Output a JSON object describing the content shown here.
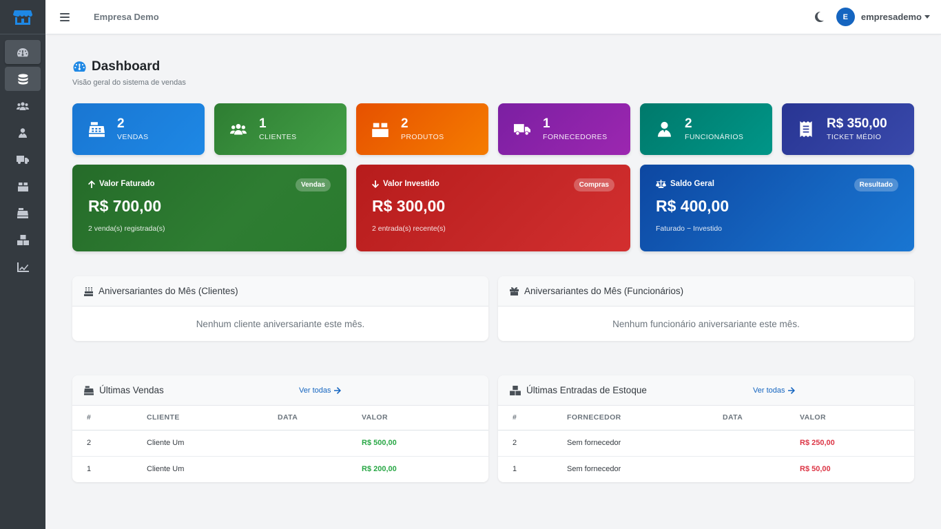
{
  "navbar": {
    "company": "Empresa Demo",
    "user_initial": "E",
    "user_name": "empresademo"
  },
  "sidebar": {
    "items": [
      {
        "icon": "tachometer-icon"
      },
      {
        "icon": "database-icon"
      },
      {
        "icon": "users-icon"
      },
      {
        "icon": "user-tie-icon"
      },
      {
        "icon": "truck-icon"
      },
      {
        "icon": "box-icon"
      },
      {
        "icon": "cash-register-icon"
      },
      {
        "icon": "boxes-icon"
      },
      {
        "icon": "chart-line-icon"
      }
    ]
  },
  "page": {
    "title": "Dashboard",
    "subtitle": "Visão geral do sistema de vendas"
  },
  "stats": [
    {
      "value": "2",
      "label": "VENDAS",
      "icon": "cash-register-icon",
      "color": "#1976d2"
    },
    {
      "value": "1",
      "label": "CLIENTES",
      "icon": "users-icon",
      "color": "#388e3c"
    },
    {
      "value": "2",
      "label": "PRODUTOS",
      "icon": "box-icon",
      "color": "#f57c00"
    },
    {
      "value": "1",
      "label": "FORNECEDORES",
      "icon": "truck-icon",
      "color": "#8e24aa"
    },
    {
      "value": "2",
      "label": "FUNCIONÁRIOS",
      "icon": "user-tie-icon",
      "color": "#00897b"
    },
    {
      "value": "R$ 350,00",
      "label": "TICKET MÉDIO",
      "icon": "receipt-icon",
      "color": "#303f9f"
    }
  ],
  "summary": [
    {
      "title": "Valor Faturado",
      "badge": "Vendas",
      "amount": "R$ 700,00",
      "note": "2 venda(s) registrada(s)",
      "icon": "arrow-up-icon",
      "color": "#2e7d32"
    },
    {
      "title": "Valor Investido",
      "badge": "Compras",
      "amount": "R$ 300,00",
      "note": "2 entrada(s) recente(s)",
      "icon": "arrow-down-icon",
      "color": "#c62828"
    },
    {
      "title": "Saldo Geral",
      "badge": "Resultado",
      "amount": "R$ 400,00",
      "note": "Faturado − Investido",
      "icon": "balance-scale-icon",
      "color": "#1565c0"
    }
  ],
  "birthdays": {
    "clients_title": "Aniversariantes do Mês (Clientes)",
    "clients_empty": "Nenhum cliente aniversariante este mês.",
    "employees_title": "Aniversariantes do Mês (Funcionários)",
    "employees_empty": "Nenhum funcionário aniversariante este mês."
  },
  "sales": {
    "title": "Últimas Vendas",
    "link": "Ver todas",
    "headers": [
      "#",
      "CLIENTE",
      "DATA",
      "VALOR"
    ],
    "rows": [
      {
        "id": "2",
        "name": "Cliente Um",
        "date": "",
        "value": "R$ 500,00"
      },
      {
        "id": "1",
        "name": "Cliente Um",
        "date": "",
        "value": "R$ 200,00"
      }
    ]
  },
  "entries": {
    "title": "Últimas Entradas de Estoque",
    "link": "Ver todas",
    "headers": [
      "#",
      "FORNECEDOR",
      "DATA",
      "VALOR"
    ],
    "rows": [
      {
        "id": "2",
        "name": "Sem fornecedor",
        "date": "",
        "value": "R$ 250,00"
      },
      {
        "id": "1",
        "name": "Sem fornecedor",
        "date": "",
        "value": "R$ 50,00"
      }
    ]
  }
}
